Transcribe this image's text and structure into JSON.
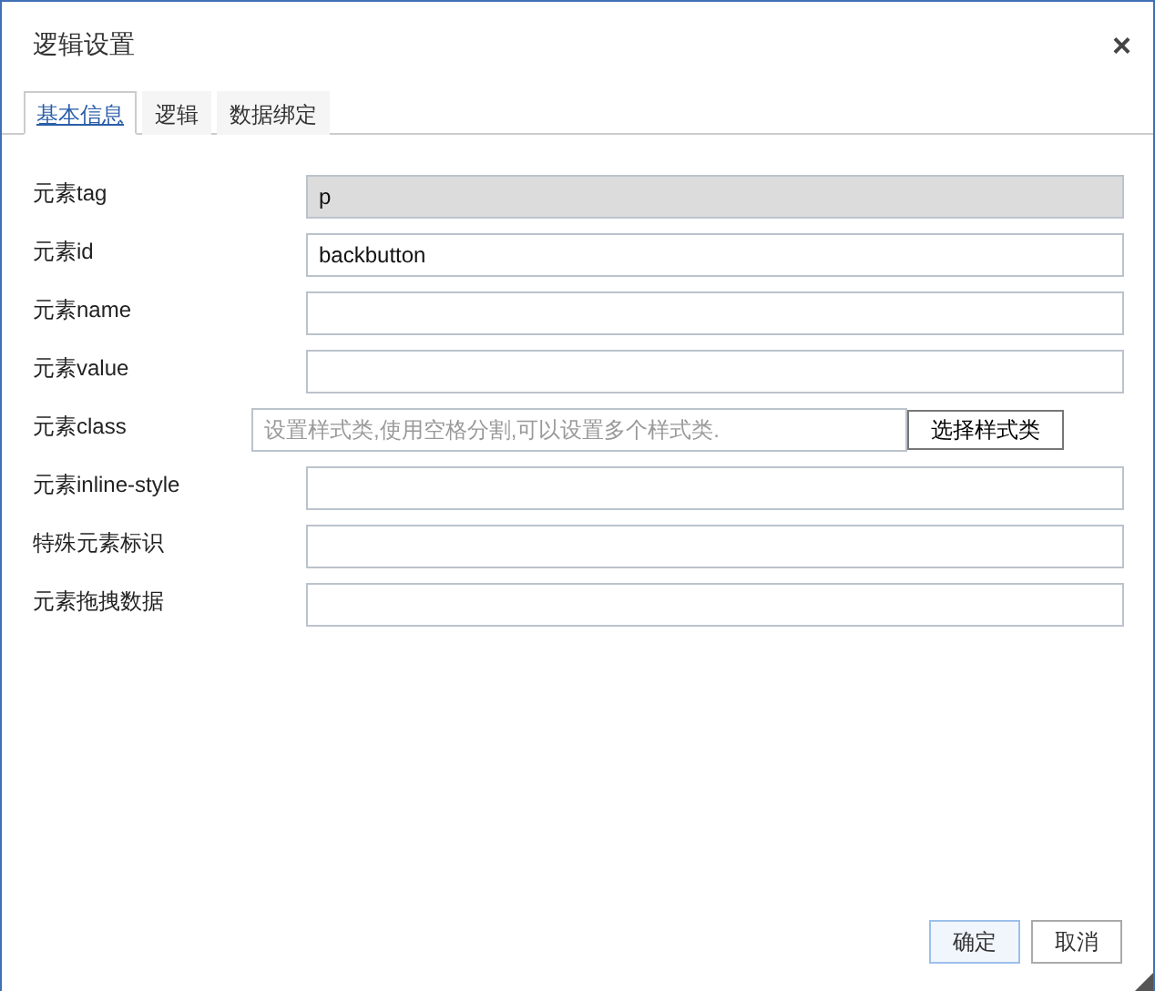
{
  "window": {
    "title": "逻辑设置",
    "close": "×"
  },
  "tabs": [
    {
      "label": "基本信息",
      "selected": true
    },
    {
      "label": "逻辑",
      "selected": false
    },
    {
      "label": "数据绑定",
      "selected": false
    }
  ],
  "fields": [
    {
      "kind": "text",
      "label": "元素tag",
      "value": "p",
      "disabled": true
    },
    {
      "kind": "text",
      "label": "元素id",
      "value": "backbutton",
      "disabled": false
    },
    {
      "kind": "text",
      "label": "元素name",
      "disabled": false
    },
    {
      "kind": "text",
      "label": "元素value",
      "disabled": false
    },
    {
      "kind": "picker",
      "label": "元素class",
      "placeholder": "设置样式类,使用空格分割,可以设置多个样式类.",
      "button": "选择样式类"
    },
    {
      "kind": "text",
      "label": "元素inline-style",
      "disabled": false
    },
    {
      "kind": "text",
      "label": "特殊元素标识",
      "disabled": false
    },
    {
      "kind": "text",
      "label": "元素拖拽数据",
      "disabled": false
    }
  ],
  "buttons": [
    {
      "label": "确定",
      "kind": "primary"
    },
    {
      "label": "取消",
      "kind": "secondary"
    }
  ]
}
